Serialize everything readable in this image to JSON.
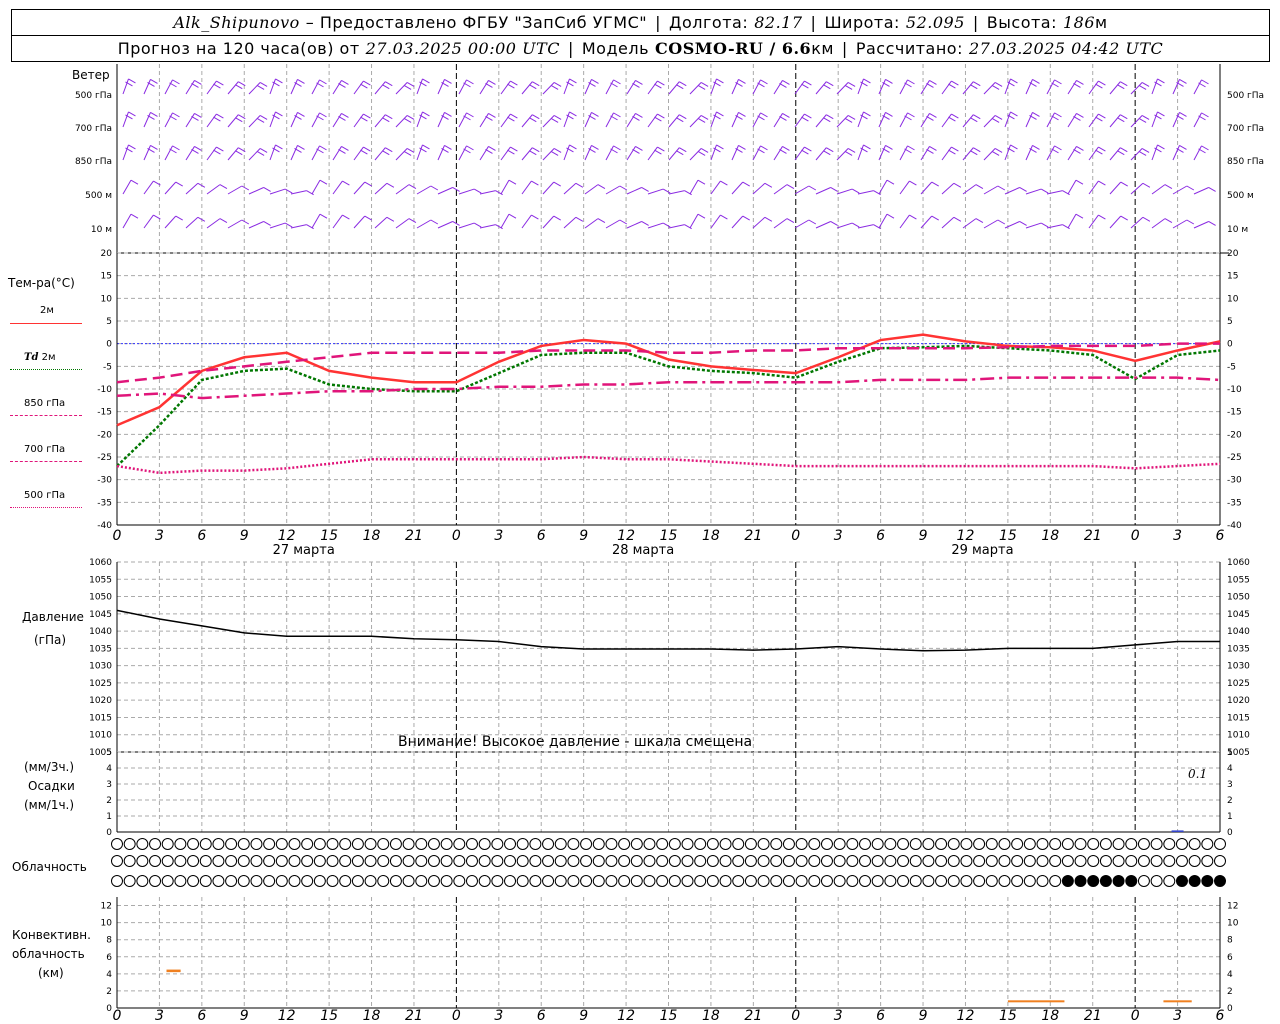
{
  "header": {
    "station": "Alk_Shipunovo",
    "provider": "– Предоставлено ФГБУ \"ЗапСиб УГМС\"",
    "lon_label": "Долгота:",
    "lon": "82.17",
    "lat_label": "Широта:",
    "lat": "52.095",
    "alt_label": "Высота:",
    "alt": "186",
    "alt_unit": "м",
    "forecast_label": "Прогноз на 120 часа(ов) от",
    "forecast_from": "27.03.2025 00:00 UTC",
    "model_label": "Модель",
    "model": "COSMO-RU / 6.6",
    "model_unit": "км",
    "calc_label": "Рассчитано:",
    "calc_time": "27.03.2025 04:42 UTC"
  },
  "wind_panel": {
    "title": "Ветер",
    "levels": [
      "500 гПа",
      "700 гПа",
      "850 гПа",
      "500 м",
      "10 м"
    ],
    "color": "#8a2be2"
  },
  "temp_panel": {
    "title": "Тем-ра(°C)",
    "legend": [
      {
        "label": "2м",
        "color": "#ff3333",
        "style": "solid"
      },
      {
        "label": "Td",
        "label2": "2м",
        "color": "#007700",
        "style": "dotted"
      },
      {
        "label": "850 гПа",
        "color": "#e0157a",
        "style": "dashed"
      },
      {
        "label": "700 гПа",
        "color": "#e0157a",
        "style": "dashdot"
      },
      {
        "label": "500 гПа",
        "color": "#e0157a",
        "style": "dotted"
      }
    ],
    "y_ticks": [
      "20",
      "15",
      "10",
      "5",
      "0",
      "-5",
      "-10",
      "-15",
      "-20",
      "-25",
      "-30",
      "-35",
      "-40"
    ]
  },
  "pressure_panel": {
    "title": "Давление",
    "unit": "(гПа)",
    "warning": "Внимание! Высокое давление - шкала смещена",
    "y_ticks": [
      "1060",
      "1055",
      "1050",
      "1045",
      "1040",
      "1035",
      "1030",
      "1025",
      "1020",
      "1015",
      "1010",
      "1005"
    ]
  },
  "precip_panel": {
    "unit3": "(мм/3ч.)",
    "title": "Осадки",
    "unit1": "(мм/1ч.)",
    "max_label": "0.1",
    "y_ticks": [
      "5",
      "4",
      "3",
      "2",
      "1",
      "0"
    ]
  },
  "cloud_panel": {
    "title": "Облачность"
  },
  "convective_panel": {
    "title1": "Конвективн.",
    "title2": "облачность",
    "unit": "(км)",
    "y_ticks": [
      "12",
      "10",
      "8",
      "6",
      "4",
      "2",
      "0"
    ]
  },
  "x_axis": {
    "ticks": [
      "0",
      "3",
      "6",
      "9",
      "12",
      "15",
      "18",
      "21",
      "0",
      "3",
      "6",
      "9",
      "12",
      "15",
      "18",
      "21",
      "0",
      "3",
      "6",
      "9",
      "12",
      "15",
      "18",
      "21",
      "0",
      "3",
      "6"
    ],
    "dates": [
      "27 марта",
      "28 марта",
      "29 марта"
    ]
  },
  "chart_data": [
    {
      "type": "line",
      "title": "Тем-ра(°C)",
      "ylim": [
        -40,
        20
      ],
      "x_hours": [
        0,
        3,
        6,
        9,
        12,
        15,
        18,
        21,
        24,
        27,
        30,
        33,
        36,
        39,
        42,
        45,
        48,
        51,
        54,
        57,
        60,
        63,
        66,
        69,
        72,
        75,
        78
      ],
      "series": [
        {
          "name": "2м",
          "values": [
            -18,
            -14,
            -6,
            -3,
            -2,
            -6,
            -7.5,
            -8.5,
            -8.5,
            -4,
            -0.5,
            0.8,
            0,
            -3.5,
            -5,
            -5.8,
            -6.5,
            -3,
            0.8,
            2,
            0.5,
            -0.5,
            -0.8,
            -1.5,
            -3.8,
            -1.5,
            0.5
          ]
        },
        {
          "name": "Td 2м",
          "values": [
            -27,
            -18,
            -8,
            -6,
            -5.5,
            -9,
            -10,
            -10.5,
            -10.5,
            -6.5,
            -2.5,
            -2,
            -2,
            -5,
            -6,
            -6.5,
            -7.5,
            -4,
            -1,
            -0.8,
            -0.5,
            -1,
            -1.5,
            -2.5,
            -7.8,
            -2.5,
            -1.5
          ]
        },
        {
          "name": "850 гПа",
          "values": [
            -8.5,
            -7.5,
            -6,
            -5,
            -4,
            -3,
            -2,
            -2,
            -2,
            -2,
            -1.5,
            -1.5,
            -1.5,
            -2,
            -2,
            -1.5,
            -1.5,
            -1,
            -1,
            -1,
            -1,
            -0.8,
            -0.5,
            -0.5,
            -0.5,
            0,
            0
          ]
        },
        {
          "name": "700 гПа",
          "values": [
            -11.5,
            -11,
            -12,
            -11.5,
            -11,
            -10.5,
            -10.5,
            -10,
            -10,
            -9.5,
            -9.5,
            -9,
            -9,
            -8.5,
            -8.5,
            -8.5,
            -8.5,
            -8.5,
            -8,
            -8,
            -8,
            -7.5,
            -7.5,
            -7.5,
            -7.5,
            -7.5,
            -8
          ]
        },
        {
          "name": "500 гПа",
          "values": [
            -27,
            -28.5,
            -28,
            -28,
            -27.5,
            -26.5,
            -25.5,
            -25.5,
            -25.5,
            -25.5,
            -25.5,
            -25,
            -25.5,
            -25.5,
            -26,
            -26.5,
            -27,
            -27,
            -27,
            -27,
            -27,
            -27,
            -27,
            -27,
            -27.5,
            -27,
            -26.5
          ]
        }
      ]
    },
    {
      "type": "line",
      "title": "Давление",
      "ylabel": "(гПа)",
      "ylim": [
        1005,
        1060
      ],
      "x_hours": [
        0,
        3,
        6,
        9,
        12,
        15,
        18,
        21,
        24,
        27,
        30,
        33,
        36,
        39,
        42,
        45,
        48,
        51,
        54,
        57,
        60,
        63,
        66,
        69,
        72,
        75,
        78
      ],
      "values": [
        1046,
        1043.5,
        1041.5,
        1039.5,
        1038.5,
        1038.5,
        1038.5,
        1037.8,
        1037.5,
        1037,
        1035.5,
        1034.8,
        1034.8,
        1034.8,
        1034.8,
        1034.5,
        1034.8,
        1035.5,
        1034.8,
        1034.3,
        1034.5,
        1035,
        1035,
        1035,
        1036,
        1037,
        1037
      ]
    },
    {
      "type": "bar",
      "title": "Осадки",
      "ylim": [
        0,
        5
      ],
      "x_hours": [
        75
      ],
      "values": [
        0.1
      ]
    },
    {
      "type": "bar",
      "title": "Конвективная облачность",
      "ylabel": "(км)",
      "ylim": [
        0,
        13
      ],
      "segments": [
        {
          "x_start": 3.5,
          "x_end": 4.5,
          "top": 4.5,
          "bottom": 4.2
        },
        {
          "x_start": 63,
          "x_end": 67,
          "top": 0.9,
          "bottom": 0.7
        },
        {
          "x_start": 74,
          "x_end": 76,
          "top": 0.9,
          "bottom": 0.7
        }
      ]
    }
  ]
}
